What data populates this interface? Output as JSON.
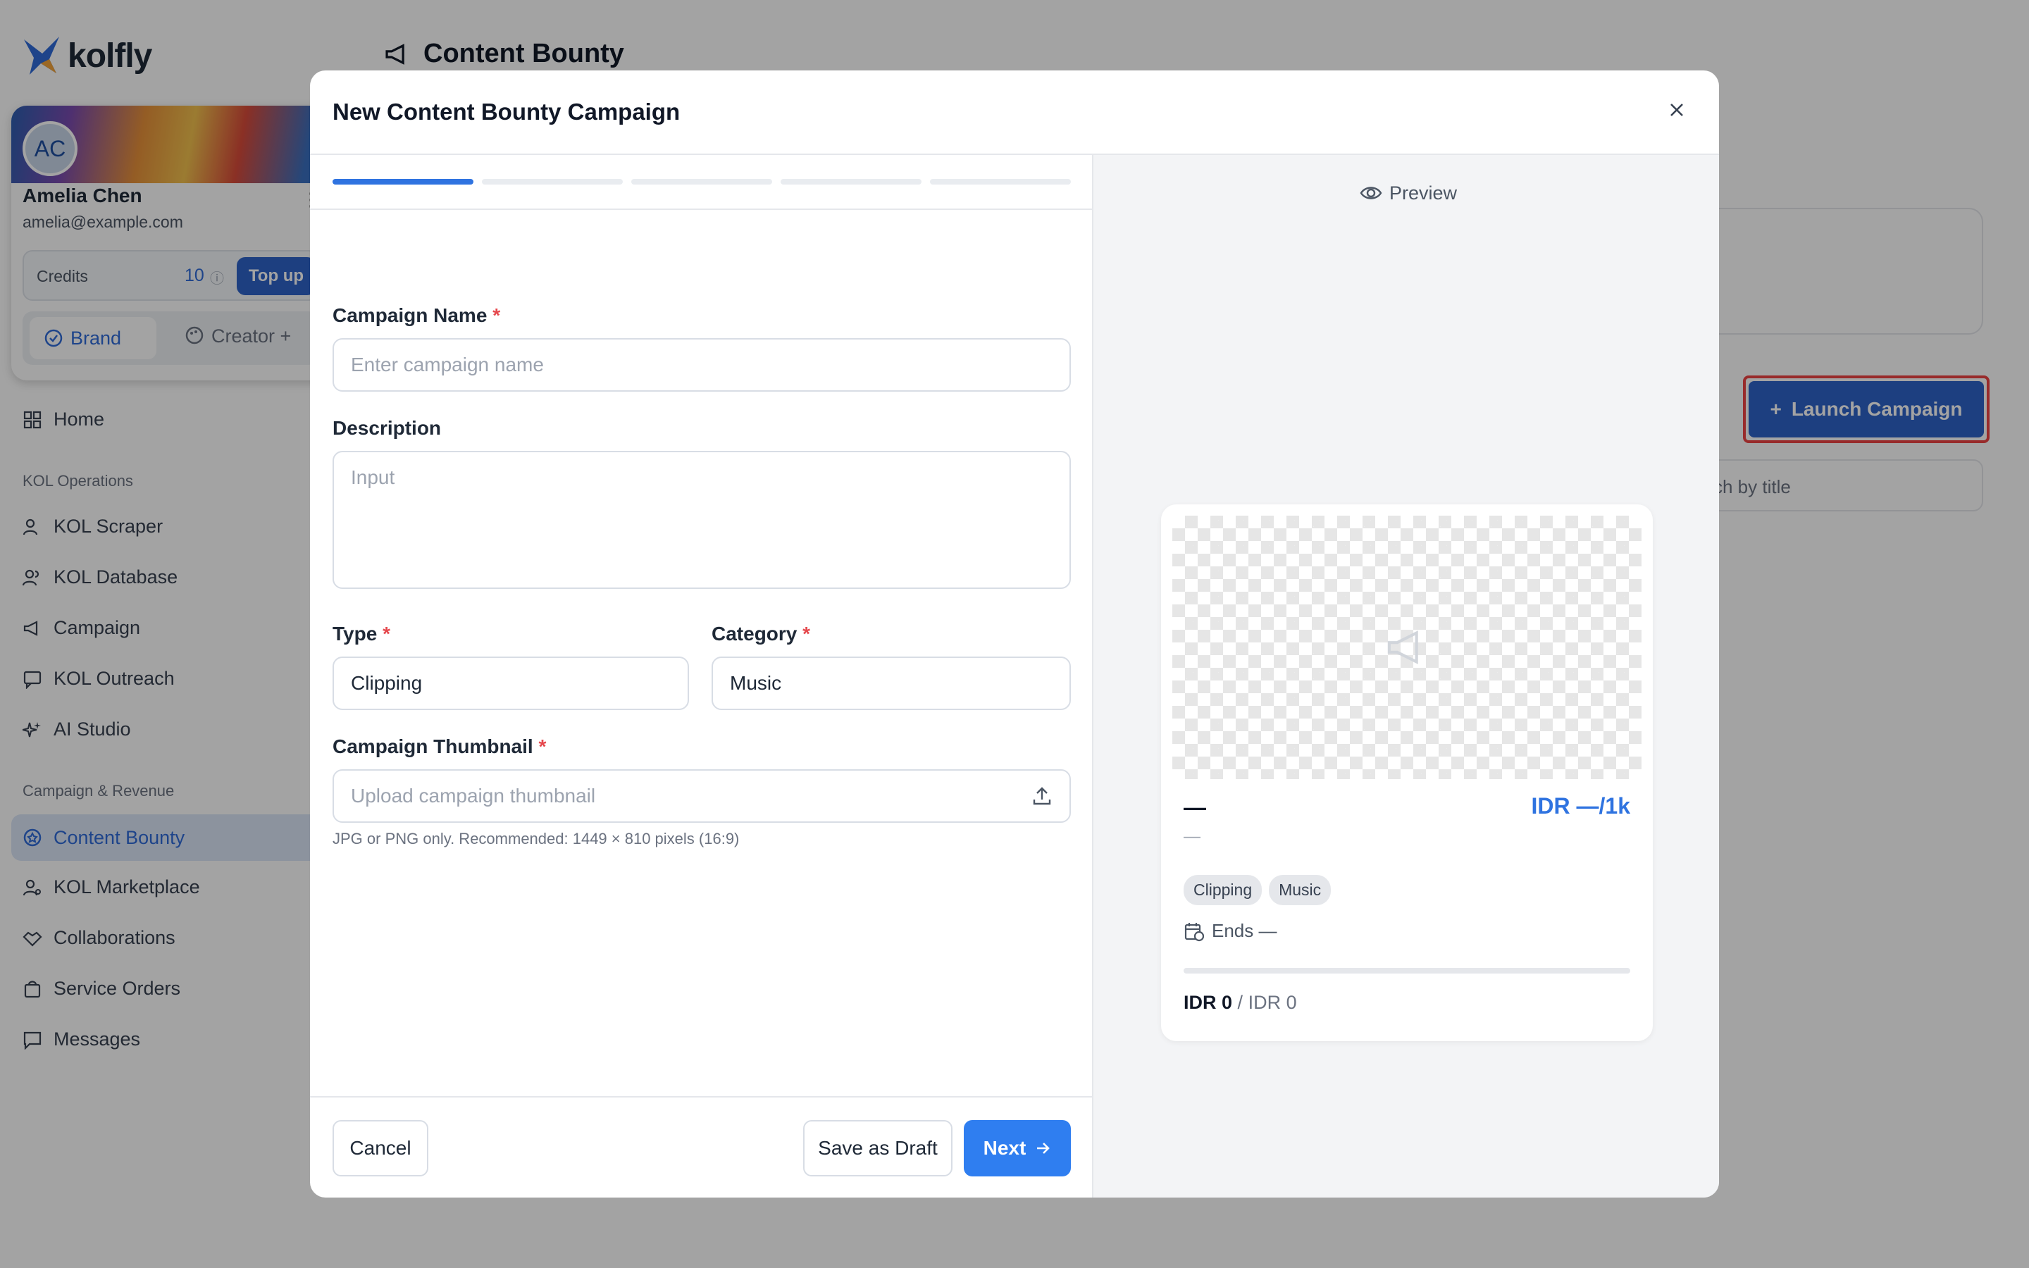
{
  "app": {
    "logo_text": "kolfly",
    "page_title": "Content Bounty"
  },
  "profile": {
    "initials": "AC",
    "name": "Amelia Chen",
    "email": "amelia@example.com",
    "credits_label": "Credits",
    "credits_value": "10",
    "topup_label": "Top up",
    "role_brand": "Brand",
    "role_creator": "Creator +"
  },
  "nav": {
    "home": "Home",
    "section_kol": "KOL Operations",
    "kol_scraper": "KOL Scraper",
    "kol_database": "KOL Database",
    "campaign": "Campaign",
    "kol_outreach": "KOL Outreach",
    "ai_studio": "AI Studio",
    "section_revenue": "Campaign & Revenue",
    "content_bounty": "Content Bounty",
    "kol_marketplace": "KOL Marketplace",
    "collaborations": "Collaborations",
    "service_orders": "Service Orders",
    "messages": "Messages"
  },
  "background": {
    "launch_label": "Launch Campaign",
    "search_partial": "ch by title"
  },
  "modal": {
    "title": "New Content Bounty Campaign",
    "progress": {
      "current_step": 1,
      "total_steps": 5
    },
    "campaign_name_label": "Campaign Name",
    "campaign_name_placeholder": "Enter campaign name",
    "description_label": "Description",
    "description_placeholder": "Input",
    "type_label": "Type",
    "type_value": "Clipping",
    "category_label": "Category",
    "category_value": "Music",
    "thumbnail_label": "Campaign Thumbnail",
    "thumbnail_placeholder": "Upload campaign thumbnail",
    "thumbnail_hint": "JPG or PNG only. Recommended: 1449 × 810 pixels (16:9)",
    "required_mark": "*",
    "cancel_label": "Cancel",
    "draft_label": "Save as Draft",
    "next_label": "Next"
  },
  "preview": {
    "header": "Preview",
    "title": "—",
    "rate": "IDR —/1k",
    "subtitle": "—",
    "tags": [
      "Clipping",
      "Music"
    ],
    "ends": "Ends —",
    "progress": 0,
    "budget_spent": "IDR 0",
    "budget_sep": "/",
    "budget_total": "IDR 0"
  },
  "colors": {
    "accent": "#2f73e0",
    "brand_blue": "#2e63c8",
    "highlight_red": "#ee4444"
  }
}
